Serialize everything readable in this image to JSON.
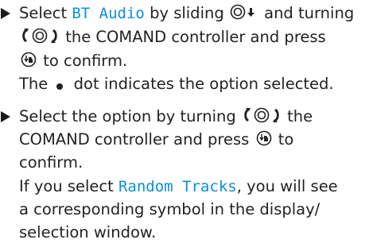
{
  "doc": {
    "accent_color": "#0b8fd6",
    "icons": [
      "bullet-arrow-icon",
      "controller-slide-down-icon",
      "controller-turn-icon",
      "controller-press-icon",
      "dot-icon"
    ],
    "step1": {
      "line1_a": "Select ",
      "line1_hl": "BT Audio",
      "line1_b": " by sliding ",
      "line1_c": " and turning",
      "line2_b": " the COMAND controller and press",
      "line3_b": " to confirm.",
      "line4_a": "The ",
      "line4_b": " dot indicates the option selected."
    },
    "step2": {
      "line1_a": "Select the option by turning ",
      "line1_b": " the",
      "line2_a": "COMAND controller and press ",
      "line2_b": " to",
      "line3": "confirm.",
      "line4_a": "If you select ",
      "line4_hl": "Random Tracks",
      "line4_b": ", you will see",
      "line5": "a corresponding symbol in the display/",
      "line6": "selection window."
    }
  }
}
